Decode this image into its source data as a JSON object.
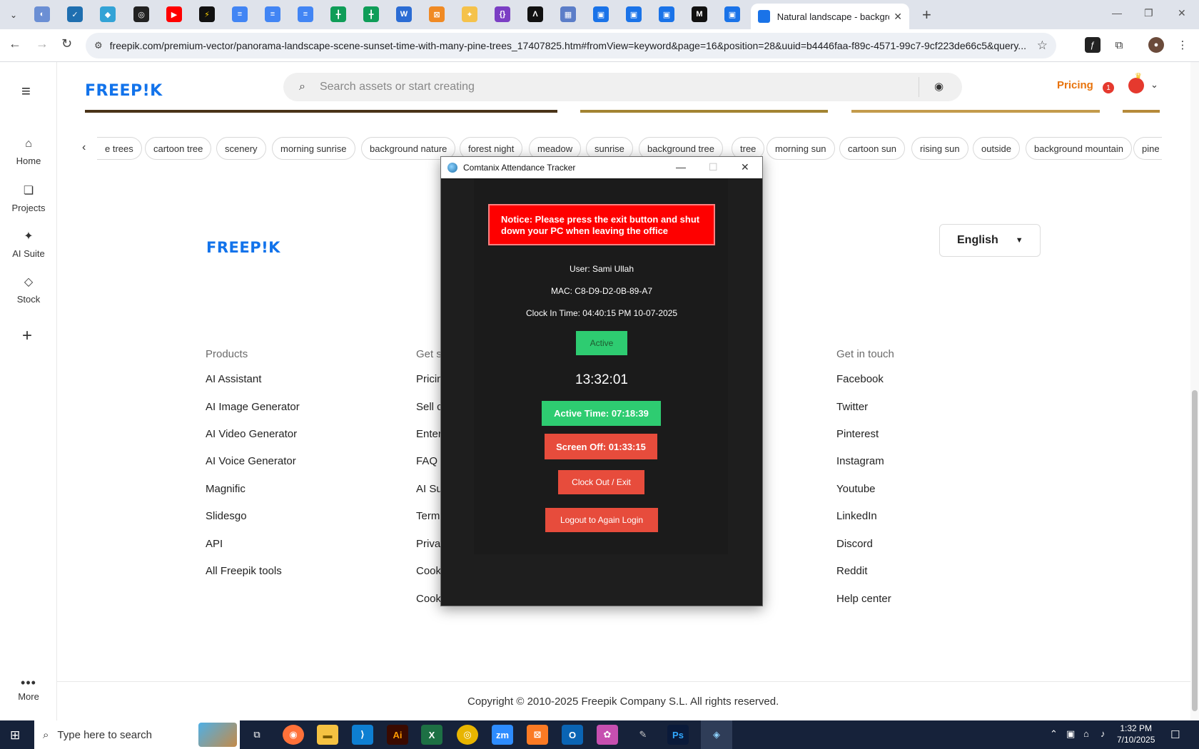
{
  "browser": {
    "active_tab_title": "Natural landscape - backgroun",
    "url": "freepik.com/premium-vector/panorama-landscape-scene-sunset-time-with-many-pine-trees_17407825.htm#fromView=keyword&page=16&position=28&uuid=b4446faa-f89c-4571-99c7-9cf223de66c5&query..."
  },
  "freepik": {
    "logo": "FREEP!K",
    "search_placeholder": "Search assets or start creating",
    "pricing": "Pricing",
    "notification_count": "1",
    "sidebar": {
      "home": "Home",
      "projects": "Projects",
      "ai_suite": "AI Suite",
      "stock": "Stock",
      "more": "More"
    },
    "tags": [
      "e trees",
      "cartoon tree",
      "scenery",
      "morning sunrise",
      "background nature",
      "forest night",
      "meadow",
      "sunrise",
      "background tree",
      "tree",
      "morning sun",
      "cartoon sun",
      "rising sun",
      "outside",
      "background mountain",
      "pine"
    ],
    "language": "English",
    "footer": {
      "col1_title": "Products",
      "col1_links": [
        "AI Assistant",
        "AI Image Generator",
        "AI Video Generator",
        "AI Voice Generator",
        "Magnific",
        "Slidesgo",
        "API",
        "All Freepik tools"
      ],
      "col2_title": "Get s",
      "col2_links": [
        "Pricin",
        "Sell c",
        "Enter",
        "FAQ",
        "AI Su",
        "Term",
        "Priva",
        "Cook",
        "Cook"
      ],
      "col4_title": "Get in touch",
      "col4_links": [
        "Facebook",
        "Twitter",
        "Pinterest",
        "Instagram",
        "Youtube",
        "LinkedIn",
        "Discord",
        "Reddit",
        "Help center"
      ],
      "copyright": "Copyright © 2010-2025 Freepik Company S.L. All rights reserved."
    }
  },
  "tracker": {
    "title": "Comtanix Attendance Tracker",
    "notice_line1": "Notice: Please press the exit button and shut",
    "notice_line2": "down your PC when leaving the office",
    "user": "User: Sami Ullah",
    "mac": "MAC: C8-D9-D2-0B-89-A7",
    "clock_in": "Clock In Time: 04:40:15 PM 10-07-2025",
    "status": "Active",
    "clock": "13:32:01",
    "active_time": "Active Time: 07:18:39",
    "screen_off": "Screen Off: 01:33:15",
    "clock_out_button": "Clock Out / Exit",
    "logout_button": "Logout to Again Login"
  },
  "taskbar": {
    "search_placeholder": "Type here to search",
    "time": "1:32 PM",
    "date": "7/10/2025"
  },
  "colors": {
    "freepik_blue": "#1273eb",
    "pricing_orange": "#e8730c",
    "notice_red": "#fe0000",
    "active_green": "#2ecc71",
    "button_red": "#e74c3c"
  }
}
